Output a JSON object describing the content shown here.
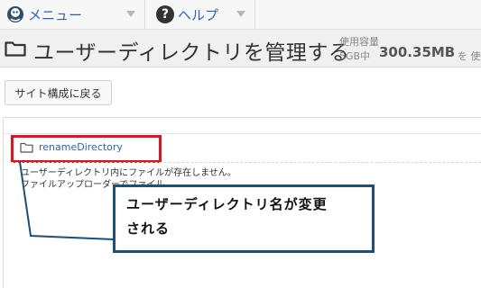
{
  "menubar": {
    "menu_label": "メニュー",
    "help_label": "ヘルプ"
  },
  "header": {
    "title": "ユーザーディレクトリを管理する",
    "quota_label": "使用容量",
    "quota_capacity": "5GB中",
    "quota_value": "300.35MB",
    "quota_suffix": "を 使"
  },
  "toolbar": {
    "back_label": "サイト構成に戻る"
  },
  "directory": {
    "name": "renameDirectory",
    "message_line1": "ユーザーディレクトリ内にファイルが存在しません。",
    "message_line2": "ファイルアップローダーでファイル"
  },
  "callout": {
    "line1": "ユーザーディレクトリ名が変更",
    "line2": "される"
  },
  "colors": {
    "link": "#2a63c4",
    "highlight": "#e0141e",
    "callout_border": "#1b4f7c"
  },
  "icons": [
    "mascot-icon",
    "chevron-down-icon",
    "help-icon",
    "folder-icon"
  ]
}
